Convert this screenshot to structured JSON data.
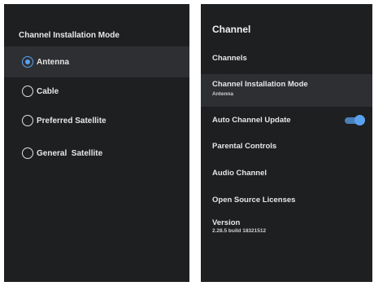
{
  "install_mode_panel": {
    "title": "Channel Installation Mode",
    "options": [
      {
        "label": "Antenna",
        "selected": true
      },
      {
        "label": "Cable",
        "selected": false
      },
      {
        "label": "Preferred Satellite",
        "selected": false
      },
      {
        "label": "General  Satellite",
        "selected": false
      }
    ]
  },
  "channel_panel": {
    "title": "Channel",
    "items": {
      "channels": "Channels",
      "install_mode": "Channel Installation Mode",
      "install_mode_value": "Antenna",
      "auto_update": "Auto Channel Update",
      "auto_update_on": true,
      "parental": "Parental Controls",
      "audio": "Audio Channel",
      "licenses": "Open Source Licenses",
      "version": "Version",
      "version_value": "2.28.5 build 18321512"
    }
  },
  "colors": {
    "panel_bg": "#1e1f21",
    "highlight_bg": "#2e2f33",
    "accent": "#5aa2f0"
  }
}
